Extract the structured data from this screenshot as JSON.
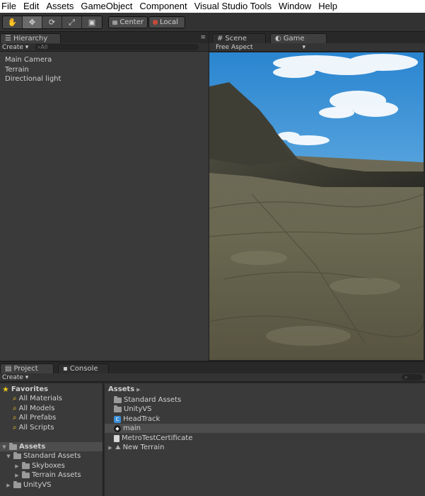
{
  "menu": [
    "File",
    "Edit",
    "Assets",
    "GameObject",
    "Component",
    "Visual Studio Tools",
    "Window",
    "Help"
  ],
  "toolbar": {
    "tools": [
      {
        "name": "hand-tool-icon",
        "glyph": "✋"
      },
      {
        "name": "move-tool-icon",
        "glyph": "✥"
      },
      {
        "name": "rotate-tool-icon",
        "glyph": "⟳"
      },
      {
        "name": "scale-tool-icon",
        "glyph": "⤢"
      },
      {
        "name": "rect-tool-icon",
        "glyph": "▣"
      }
    ],
    "pivot_label": "Center",
    "space_label": "Local"
  },
  "hierarchy": {
    "tab_label": "Hierarchy",
    "create_label": "Create",
    "search_placeholder": "All",
    "items": [
      "Main Camera",
      "Terrain",
      "Directional light"
    ]
  },
  "scene_tab": "Scene",
  "game": {
    "tab_label": "Game",
    "aspect_label": "Free Aspect"
  },
  "project": {
    "tab_label": "Project",
    "console_tab_label": "Console",
    "create_label": "Create",
    "favorites": {
      "label": "Favorites",
      "items": [
        "All Materials",
        "All Models",
        "All Prefabs",
        "All Scripts"
      ]
    },
    "tree": {
      "assets_label": "Assets",
      "children": [
        {
          "label": "Standard Assets",
          "children": [
            "Skyboxes",
            "Terrain Assets"
          ]
        },
        {
          "label": "UnityVS"
        }
      ]
    },
    "breadcrumb": "Assets",
    "assets": [
      {
        "label": "Standard Assets",
        "icon": "folder-icon"
      },
      {
        "label": "UnityVS",
        "icon": "folder-icon"
      },
      {
        "label": "HeadTrack",
        "icon": "csharp-script-icon"
      },
      {
        "label": "main",
        "icon": "unity-scene-icon"
      },
      {
        "label": "MetroTestCertificate",
        "icon": "certificate-file-icon"
      },
      {
        "label": "New Terrain",
        "icon": "terrain-icon"
      }
    ]
  },
  "colors": {
    "editor_bg": "#3a3a3a",
    "tab_bg": "#282828",
    "sky_top": "#2d8fd4",
    "sky_bottom": "#a6d1ee",
    "ground": "#6b6a52"
  }
}
